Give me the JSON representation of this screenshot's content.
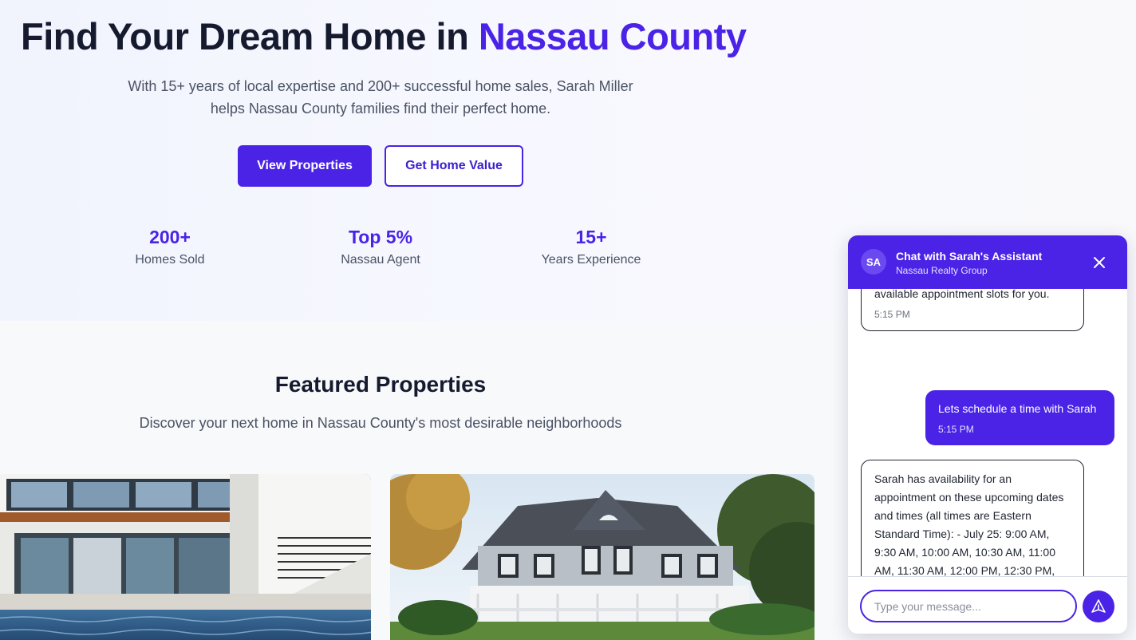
{
  "hero": {
    "title_main": "Find Your Dream Home in ",
    "title_accent": "Nassau County",
    "subtitle": "With 15+ years of local expertise and 200+ successful home sales, Sarah Miller helps Nassau County families find their perfect home.",
    "primary_button": "View Properties",
    "secondary_button": "Get Home Value",
    "stats": [
      {
        "value": "200+",
        "label": "Homes Sold"
      },
      {
        "value": "Top 5%",
        "label": "Nassau Agent"
      },
      {
        "value": "15+",
        "label": "Years Experience"
      }
    ]
  },
  "featured": {
    "title": "Featured Properties",
    "subtitle": "Discover your next home in Nassau County's most desirable neighborhoods"
  },
  "chat": {
    "avatar_initials": "SA",
    "title": "Chat with Sarah's Assistant",
    "subtitle": "Nassau Realty Group",
    "messages": [
      {
        "sender": "assistant",
        "text": "Would you like to take the next steps? If yes, I can check her upcoming available appointment slots for you.",
        "time": "5:15 PM"
      },
      {
        "sender": "user",
        "text": "Lets schedule a time with Sarah",
        "time": "5:15 PM"
      },
      {
        "sender": "assistant",
        "text": "Sarah has availability for an appointment on these upcoming dates and times (all times are Eastern Standard Time): - July 25: 9:00 AM, 9:30 AM, 10:00 AM, 10:30 AM, 11:00 AM, 11:30 AM, 12:00 PM, 12:30 PM,",
        "time": ""
      }
    ],
    "input_placeholder": "Type your message..."
  },
  "colors": {
    "accent": "#4a23e6",
    "heading": "#151a2e",
    "body_text": "#4a5263"
  },
  "icons": {
    "close": "close-icon",
    "send": "send-icon"
  }
}
